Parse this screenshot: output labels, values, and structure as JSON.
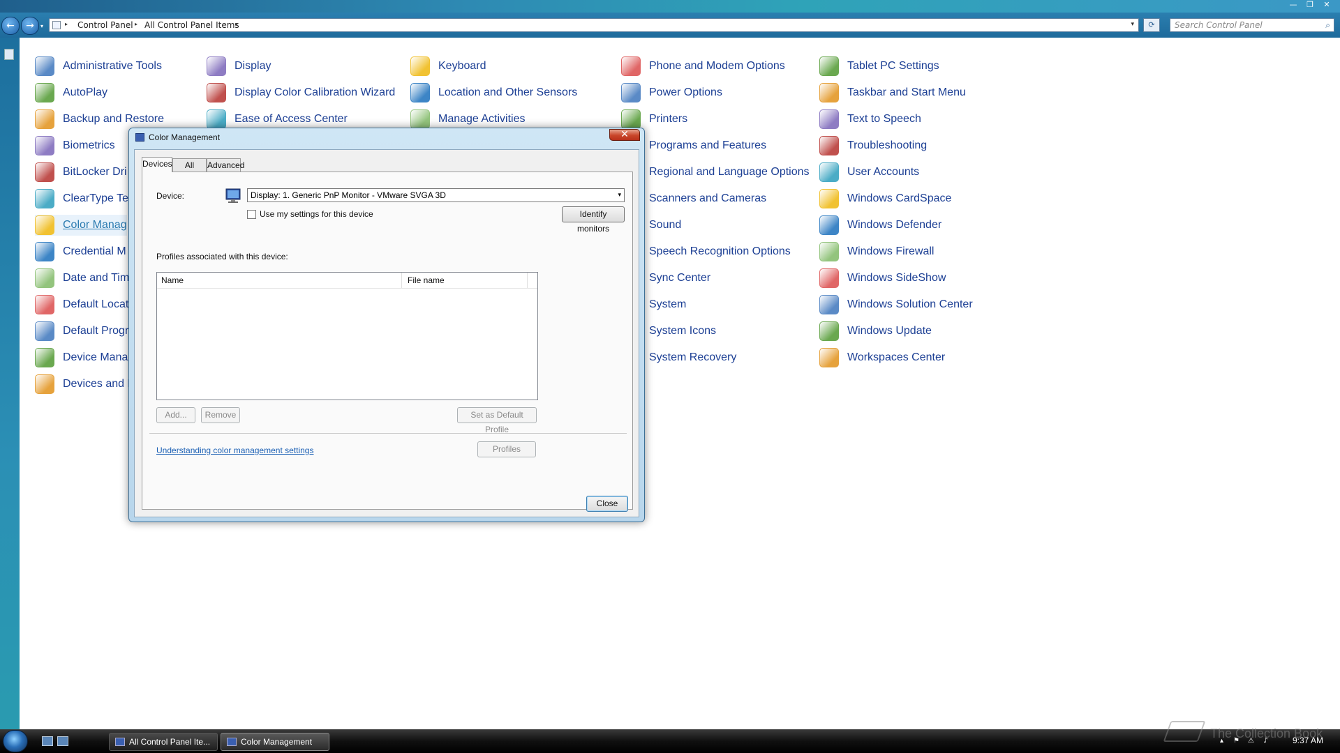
{
  "window": {
    "controls": [
      "—",
      "❐",
      "✕"
    ]
  },
  "navbar": {
    "back_icon": "←",
    "forward_icon": "→",
    "dropdown_icon": "▾",
    "breadcrumbs": [
      "Control Panel",
      "All Control Panel Items"
    ],
    "refresh_icon": "⟳",
    "search_placeholder": "Search Control Panel",
    "search_icon": "⌕"
  },
  "control_panel": {
    "columns": [
      [
        "Administrative Tools",
        "AutoPlay",
        "Backup and Restore",
        "Biometrics",
        "BitLocker Dri",
        "ClearType Te",
        "Color Manag",
        "Credential M",
        "Date and Tim",
        "Default Locat",
        "Default Progr",
        "Device Mana",
        "Devices and P"
      ],
      [
        "Display",
        "Display Color Calibration Wizard",
        "Ease of Access Center"
      ],
      [
        "Keyboard",
        "Location and Other Sensors",
        "Manage Activities"
      ],
      [
        "Phone and Modem Options",
        "Power Options",
        "Printers",
        "Programs and Features",
        "Regional and Language Options",
        "Scanners and Cameras",
        "Sound",
        "Speech Recognition Options",
        "Sync Center",
        "System",
        "System Icons",
        "System Recovery"
      ],
      [
        "Tablet PC Settings",
        "Taskbar and Start Menu",
        "Text to Speech",
        "Troubleshooting",
        "User Accounts",
        "Windows CardSpace",
        "Windows Defender",
        "Windows Firewall",
        "Windows SideShow",
        "Windows Solution Center",
        "Windows Update",
        "Workspaces Center"
      ]
    ],
    "selected": "Color Manag"
  },
  "dialog": {
    "title": "Color Management",
    "close_glyph": "✕",
    "tabs": [
      "Devices",
      "All Profiles",
      "Advanced"
    ],
    "active_tab": "Devices",
    "device_label": "Device:",
    "device_value": "Display: 1. Generic PnP Monitor - VMware SVGA 3D",
    "dropdown_arrow": "▾",
    "use_my_settings": "Use my settings for this device",
    "identify_monitors": "Identify monitors",
    "profiles_label": "Profiles associated with this device:",
    "columns": [
      "Name",
      "File name"
    ],
    "add": "Add...",
    "remove": "Remove",
    "set_default": "Set as Default Profile",
    "link": "Understanding color management settings",
    "profiles": "Profiles",
    "close": "Close"
  },
  "taskbar": {
    "tasks": [
      "All Control Panel Ite...",
      "Color Management"
    ],
    "active_task": "Color Management",
    "tray_icons": [
      "▴",
      "⚑",
      "⚠",
      "♪"
    ],
    "clock": "9:37 AM"
  },
  "watermark": "The Collection Book"
}
